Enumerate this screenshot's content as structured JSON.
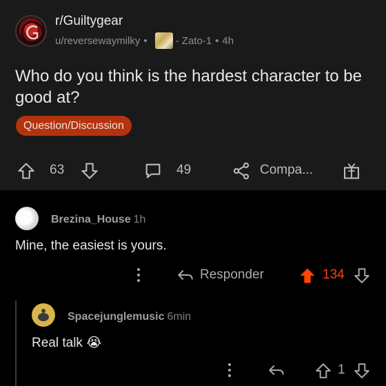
{
  "post": {
    "subreddit": "r/Guiltygear",
    "author": "u/reversewaymilky",
    "user_flair": "- Zato-1",
    "separator": "•",
    "age": "4h",
    "title": "Who do you think is the hardest character to be good at?",
    "post_flair": "Question/Discussion",
    "votes": "63",
    "comments": "49",
    "share_label": "Compa..."
  },
  "comments": [
    {
      "author": "Brezina_House",
      "time": "1h",
      "body": "Mine, the easiest is yours.",
      "reply_label": "Responder",
      "votes": "134"
    },
    {
      "author": "Spacejunglemusic",
      "time": "6min",
      "body": "Real talk 😭",
      "votes": "1"
    }
  ],
  "colors": {
    "accent": "#ff4500",
    "flair_bg": "#b4330f",
    "post_bg": "#1a1a1b",
    "page_bg": "#000000"
  },
  "icons": [
    "subreddit-avatar",
    "upvote-icon",
    "downvote-icon",
    "comment-icon",
    "share-icon",
    "award-icon",
    "more-icon",
    "reply-icon"
  ]
}
